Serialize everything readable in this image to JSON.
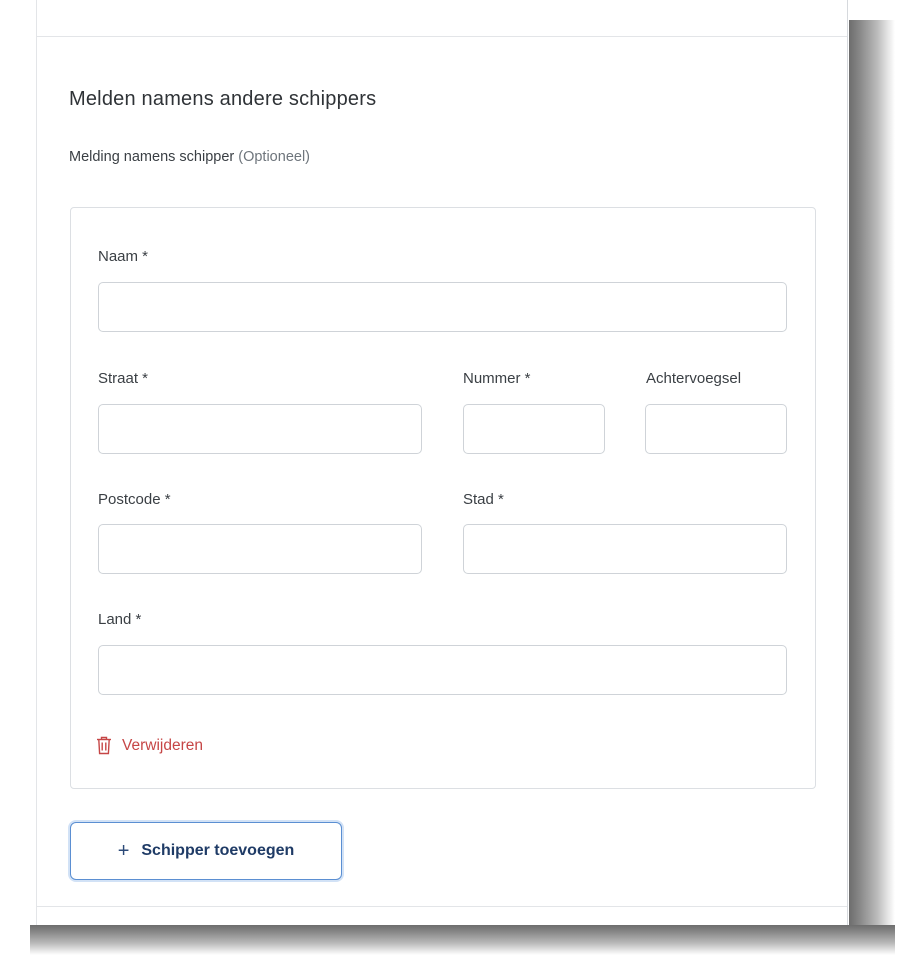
{
  "section": {
    "title": "Melden namens andere schippers",
    "subtitle": "Melding namens schipper",
    "optional": "(Optioneel)"
  },
  "form": {
    "naam_label": "Naam *",
    "naam_value": "",
    "straat_label": "Straat *",
    "straat_value": "",
    "nummer_label": "Nummer *",
    "nummer_value": "",
    "achtervoegsel_label": "Achtervoegsel",
    "achtervoegsel_value": "",
    "postcode_label": "Postcode *",
    "postcode_value": "",
    "stad_label": "Stad *",
    "stad_value": "",
    "land_label": "Land *",
    "land_value": ""
  },
  "actions": {
    "delete_label": "Verwijderen",
    "delete_icon": "trash-icon",
    "add_label": "Schipper toevoegen",
    "add_icon": "plus-icon"
  },
  "colors": {
    "danger": "#c64646",
    "primary_border": "#5b8fd2",
    "primary_text": "#1f3b66"
  }
}
